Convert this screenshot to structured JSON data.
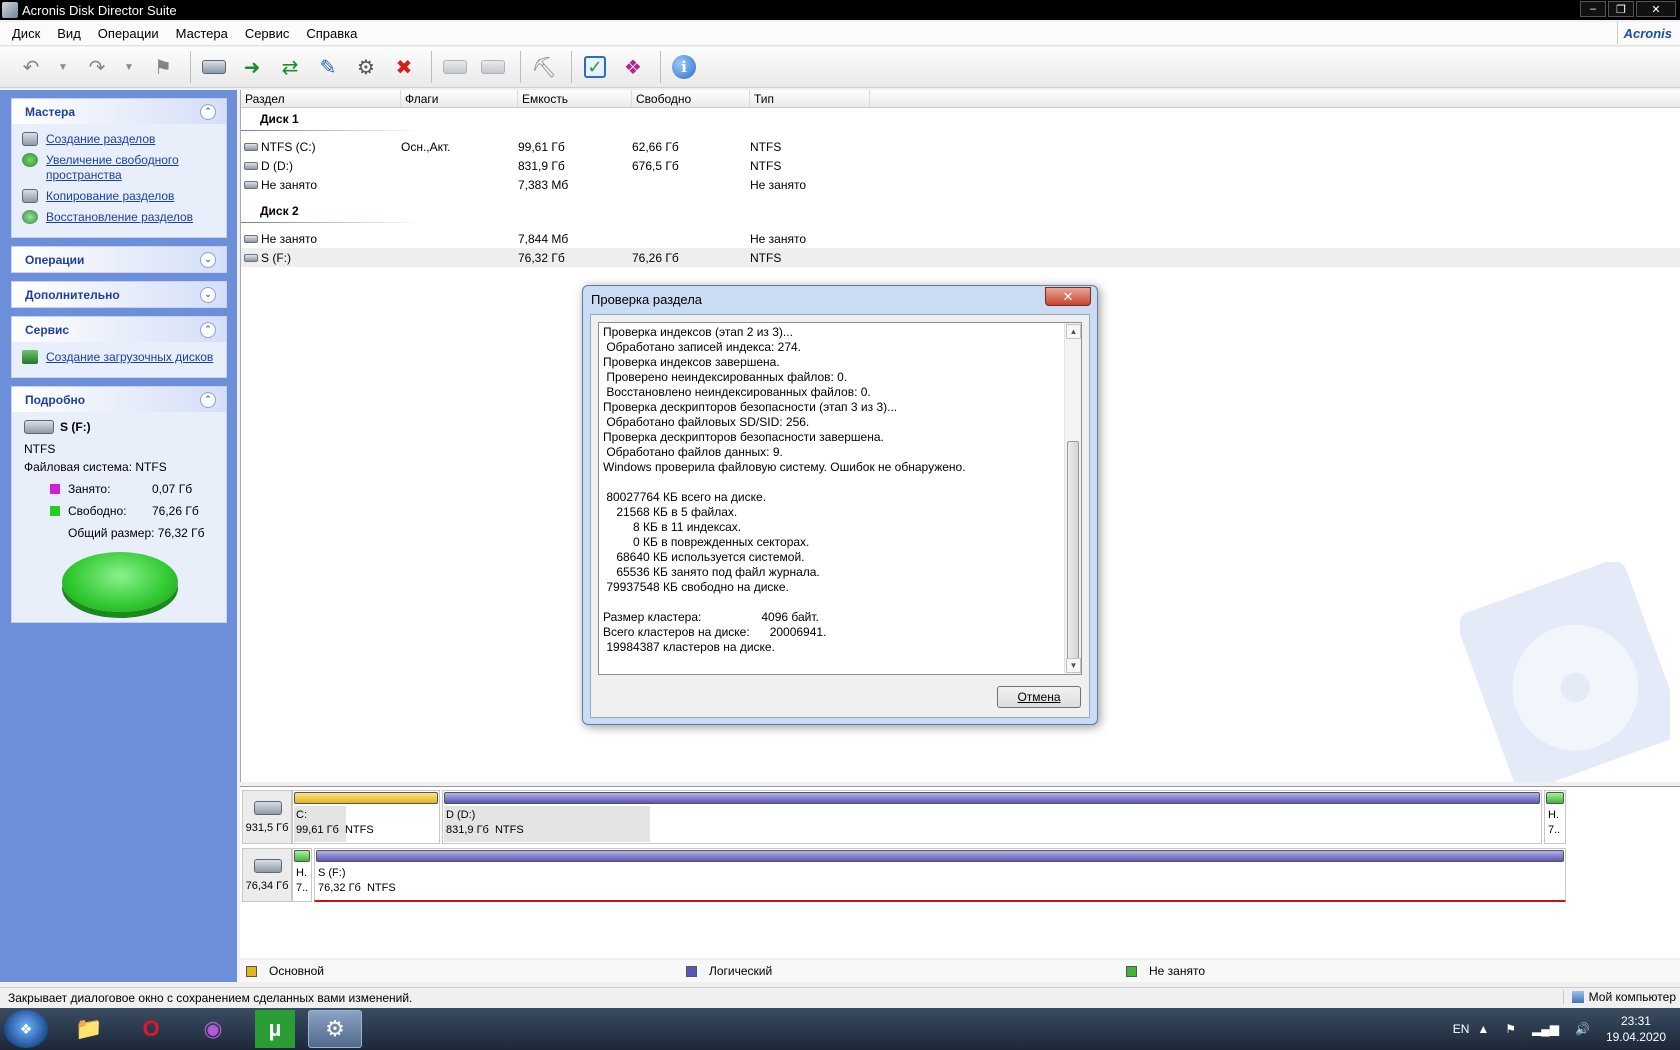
{
  "window": {
    "title": "Acronis Disk Director Suite",
    "min": "0",
    "max": "1",
    "close": "r"
  },
  "menu": [
    "Диск",
    "Вид",
    "Операции",
    "Мастера",
    "Сервис",
    "Справка"
  ],
  "brand": "Acronis",
  "sidebar": {
    "wizards": {
      "title": "Мастера",
      "items": [
        "Создание разделов",
        "Увеличение свободного пространства",
        "Копирование разделов",
        "Восстановление разделов"
      ]
    },
    "operations": {
      "title": "Операции"
    },
    "advanced": {
      "title": "Дополнительно"
    },
    "service": {
      "title": "Сервис",
      "items": [
        "Создание загрузочных дисков"
      ]
    },
    "details": {
      "title": "Подробно",
      "name": "S (F:)",
      "fs_short": "NTFS",
      "fs_line": "Файловая система: NTFS",
      "used_label": "Занято:",
      "used_value": "0,07 Гб",
      "free_label": "Свободно:",
      "free_value": "76,26 Гб",
      "total": "Общий размер: 76,32 Гб"
    }
  },
  "table": {
    "columns": [
      "Раздел",
      "Флаги",
      "Емкость",
      "Свободно",
      "Тип"
    ],
    "disk1": "Диск 1",
    "disk1_rows": [
      [
        "NTFS (C:)",
        "Осн.,Акт.",
        "99,61 Гб",
        "62,66 Гб",
        "NTFS"
      ],
      [
        "D (D:)",
        "",
        "831,9 Гб",
        "676,5 Гб",
        "NTFS"
      ],
      [
        "Не занято",
        "",
        "7,383 Мб",
        "",
        "Не занято"
      ]
    ],
    "disk2": "Диск 2",
    "disk2_rows": [
      [
        "Не занято",
        "",
        "7,844 Мб",
        "",
        "Не занято"
      ],
      [
        "S (F:)",
        "",
        "76,32 Гб",
        "76,26 Гб",
        "NTFS"
      ]
    ]
  },
  "dialog": {
    "title": "Проверка раздела",
    "close": "x",
    "log": "Проверка индексов (этап 2 из 3)...\n Обработано записей индекса: 274.\nПроверка индексов завершена.\n Проверено неиндексированных файлов: 0.\n Восстановлено неиндексированных файлов: 0.\nПроверка дескрипторов безопасности (этап 3 из 3)...\n Обработано файловых SD/SID: 256.\nПроверка дескрипторов безопасности завершена.\n Обработано файлов данных: 9.\nWindows проверила файловую систему. Ошибок не обнаружено.\n\n 80027764 КБ всего на диске.\n    21568 КБ в 5 файлах.\n         8 КБ в 11 индексах.\n         0 КБ в поврежденных секторах.\n    68640 КБ используется системой.\n    65536 КБ занято под файл журнала.\n 79937548 КБ свободно на диске.\n\nРазмер кластера:                  4096 байт.\nВсего кластеров на диске:      20006941.\n 19984387 кластеров на диске.",
    "cancel": "Отмена"
  },
  "diskmap": {
    "disk1": {
      "size": "931,5 Гб",
      "c_label": "C:",
      "c_info": "99,61 Гб  NTFS",
      "d_label": "D (D:)",
      "d_info": "831,9 Гб  NTFS",
      "u_label": "Н.",
      "u_info": "7.."
    },
    "disk2": {
      "size": "76,34 Гб",
      "u_label": "Н.",
      "u_info": "7..",
      "s_label": "S (F:)",
      "s_info": "76,32 Гб  NTFS"
    }
  },
  "legend": [
    "Основной",
    "Логический",
    "Не занято"
  ],
  "colors": {
    "primary": "#e2b51d",
    "logical": "#5a55b6",
    "unallocated": "#43b43a",
    "used": "#d11fd1",
    "free": "#22d022"
  },
  "status": {
    "text": "Закрывает диалоговое окно с сохранением сделанных вами изменений.",
    "right": "Мой компьютер"
  },
  "taskbar": {
    "lang": "EN",
    "time": "23:31",
    "date": "19.04.2020"
  }
}
